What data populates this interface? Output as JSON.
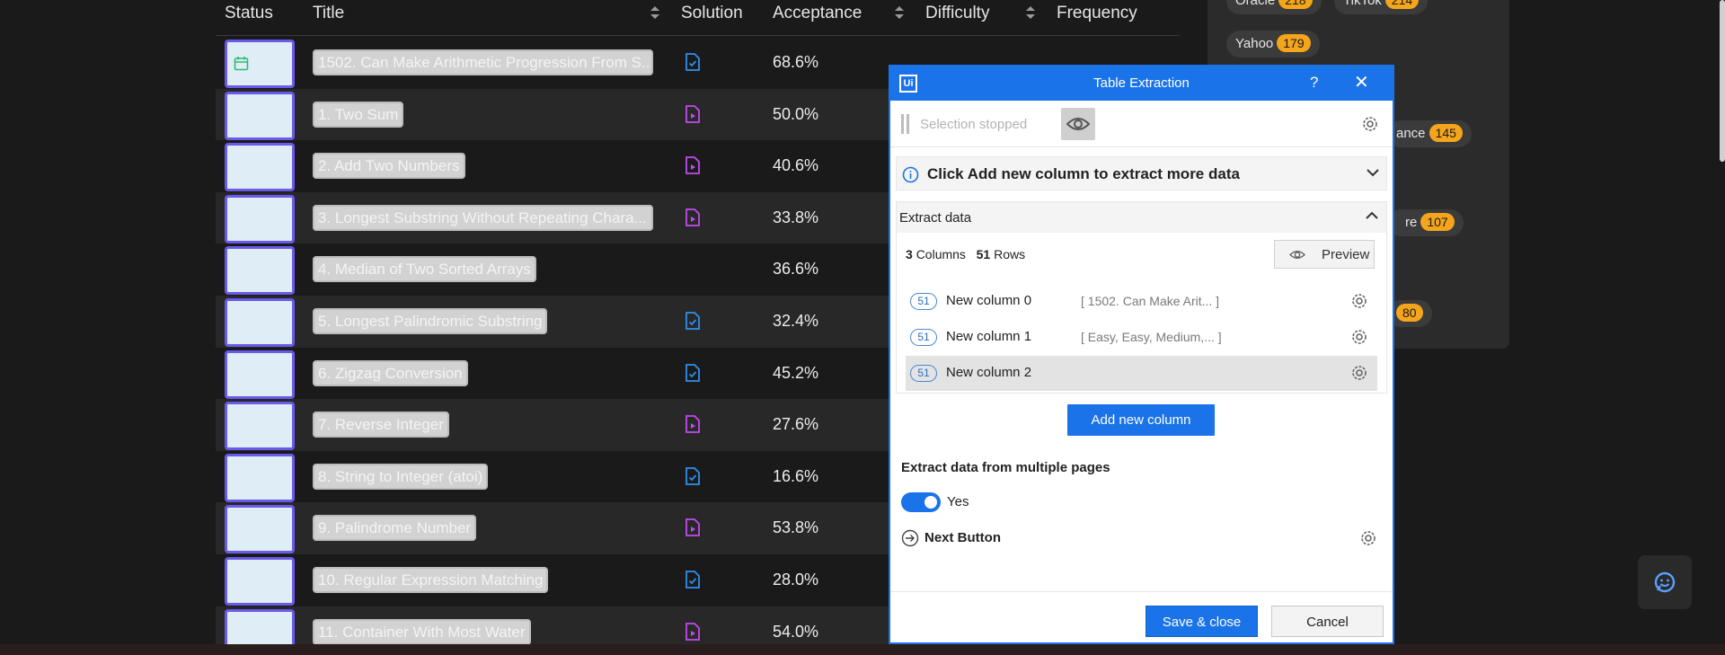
{
  "table": {
    "headers": {
      "status": "Status",
      "title": "Title",
      "solution": "Solution",
      "acceptance": "Acceptance",
      "difficulty": "Difficulty",
      "frequency": "Frequency"
    },
    "rows": [
      {
        "title": "1502. Can Make Arithmetic Progression From S...",
        "solution_icon": "file-check-icon",
        "acceptance": "68.6%",
        "status_icon": "calendar-icon"
      },
      {
        "title": "1. Two Sum",
        "solution_icon": "file-video-icon",
        "acceptance": "50.0%"
      },
      {
        "title": "2. Add Two Numbers",
        "solution_icon": "file-video-icon",
        "acceptance": "40.6%"
      },
      {
        "title": "3. Longest Substring Without Repeating Chara...",
        "solution_icon": "file-video-icon",
        "acceptance": "33.8%"
      },
      {
        "title": "4. Median of Two Sorted Arrays",
        "solution_icon": "",
        "acceptance": "36.6%"
      },
      {
        "title": "5. Longest Palindromic Substring",
        "solution_icon": "file-check-icon",
        "acceptance": "32.4%"
      },
      {
        "title": "6. Zigzag Conversion",
        "solution_icon": "file-check-icon",
        "acceptance": "45.2%"
      },
      {
        "title": "7. Reverse Integer",
        "solution_icon": "file-video-icon",
        "acceptance": "27.6%"
      },
      {
        "title": "8. String to Integer (atoi)",
        "solution_icon": "file-check-icon",
        "acceptance": "16.6%"
      },
      {
        "title": "9. Palindrome Number",
        "solution_icon": "file-video-icon",
        "acceptance": "53.8%"
      },
      {
        "title": "10. Regular Expression Matching",
        "solution_icon": "file-check-icon",
        "acceptance": "28.0%"
      },
      {
        "title": "11. Container With Most Water",
        "solution_icon": "file-video-icon",
        "acceptance": "54.0%"
      }
    ]
  },
  "companies": [
    {
      "name": "Oracle",
      "count": "218"
    },
    {
      "name": "TikTok",
      "count": "214"
    },
    {
      "name": "Yahoo",
      "count": "179"
    },
    {
      "name": "ance",
      "count": "145"
    },
    {
      "name": "re",
      "count": "107"
    },
    {
      "name": "",
      "count": "80"
    }
  ],
  "dialog": {
    "logo": "Ui",
    "title": "Table Extraction",
    "help": "?",
    "close": "✕",
    "selection_status": "Selection stopped",
    "info_text": "Click Add new column to extract more data",
    "extract_label": "Extract data",
    "columns_count": "3",
    "columns_label": "Columns",
    "rows_count": "51",
    "rows_label": "Rows",
    "preview_label": "Preview",
    "columns": [
      {
        "count": "51",
        "name": "New column 0",
        "preview": "[ 1502. Can Make Arit... ]"
      },
      {
        "count": "51",
        "name": "New column 1",
        "preview": "[ Easy, Easy, Medium,... ]"
      },
      {
        "count": "51",
        "name": "New column 2",
        "preview": ""
      }
    ],
    "add_column_label": "Add new column",
    "multi_pages_label": "Extract data from multiple pages",
    "toggle_label": "Yes",
    "toggle_on": true,
    "next_button_label": "Next Button",
    "save_label": "Save & close",
    "cancel_label": "Cancel"
  },
  "colors": {
    "accent": "#1a73e8",
    "selection_border": "#6a5ae8",
    "badge": "#f4a51c",
    "check_icon": "#2f8ff0",
    "video_icon": "#c14af0"
  }
}
